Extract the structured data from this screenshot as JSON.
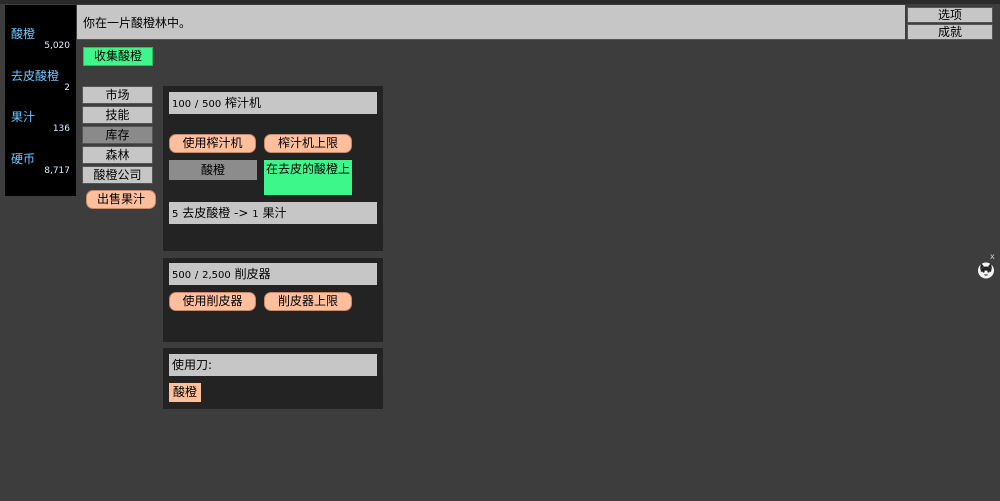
{
  "resources": [
    {
      "name": "酸橙",
      "value": "5,020"
    },
    {
      "name": "去皮酸橙",
      "value": "2"
    },
    {
      "name": "果汁",
      "value": "136"
    },
    {
      "name": "硬币",
      "value": "8,717"
    }
  ],
  "message": "你在一片酸橙林中。",
  "top_buttons": {
    "options": "选项",
    "achievements": "成就"
  },
  "collect_button": "收集酸橙",
  "nav": [
    "市场",
    "技能",
    "库存",
    "森林",
    "酸橙公司"
  ],
  "nav_active": "库存",
  "sell_juice_button": "出售果汁",
  "juicer_panel": {
    "count": "100",
    "separator": "/",
    "capacity": "500",
    "name": "榨汁机",
    "use_button": "使用榨汁机",
    "limit_button": "榨汁机上限",
    "mode_label": "酸橙",
    "mode_option": "在去皮的酸橙上",
    "recipe_num": "5",
    "recipe_text": "去皮酸橙 ->",
    "recipe_result_num": "1",
    "recipe_result": "果汁"
  },
  "peeler_panel": {
    "count": "500",
    "separator": "/",
    "capacity": "2,500",
    "name": "削皮器",
    "use_button": "使用削皮器",
    "limit_button": "削皮器上限"
  },
  "knife_panel": {
    "label": "使用刀:",
    "option": "酸橙"
  },
  "mascot": {
    "icon": "cat-face-icon",
    "close": "x"
  },
  "colors": {
    "background": "#3d3d3d",
    "panel": "#232323",
    "green": "#3ef78a",
    "peach": "#ffbf9d",
    "resource_name": "#6ec6ff"
  }
}
